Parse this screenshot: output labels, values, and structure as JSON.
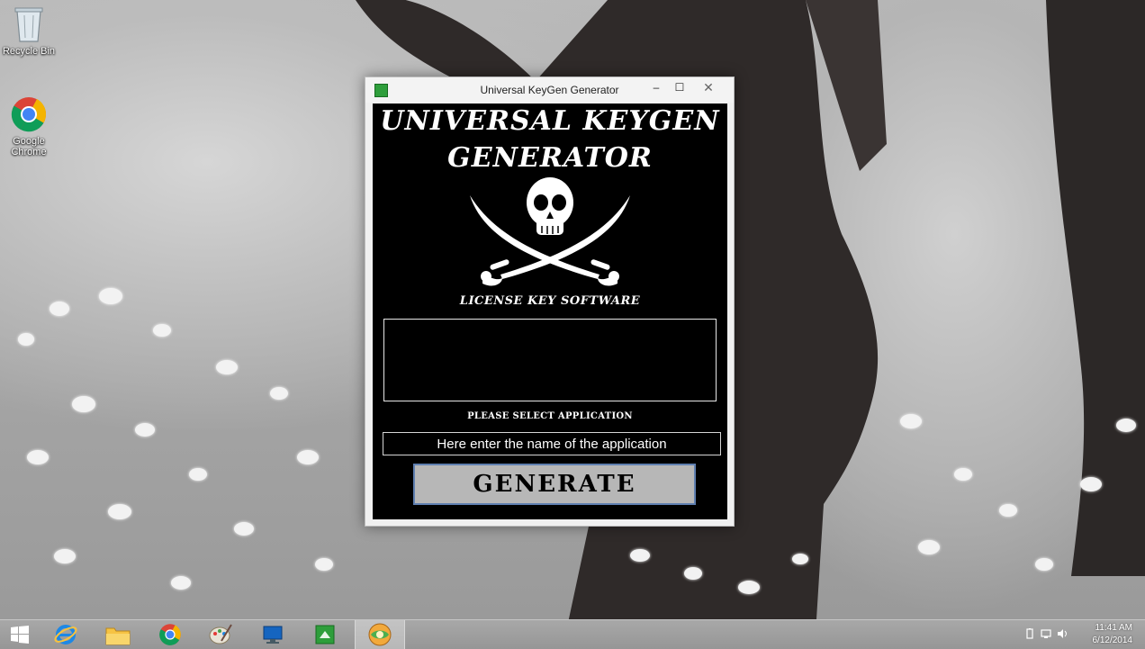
{
  "desktop": {
    "icons": [
      {
        "label": "Recycle Bin",
        "icon": "recycle-bin-icon"
      },
      {
        "label": "Google Chrome",
        "icon": "chrome-icon"
      }
    ]
  },
  "window": {
    "title": "Universal KeyGen Generator",
    "minimize_glyph": "–",
    "maximize_glyph": "☐",
    "close_glyph": "✕",
    "heading_line1": "UNIVERSAL KEYGEN",
    "heading_line2": "GENERATOR",
    "subtitle": "LICENSE KEY SOFTWARE",
    "output_value": "",
    "select_label": "PLEASE SELECT APPLICATION",
    "app_input_value": "Here enter the name of the application",
    "generate_label": "GENERATE"
  },
  "taskbar": {
    "items": [
      "start-icon",
      "internet-explorer-icon",
      "file-explorer-icon",
      "chrome-icon",
      "paint-icon",
      "remote-desktop-icon",
      "keygen-app-icon",
      "browser-app-icon"
    ],
    "active_item": "browser-app-icon"
  },
  "tray": {
    "time": "11:41 AM",
    "date": "6/12/2014"
  },
  "colors": {
    "window_client": "#000000",
    "button_face": "#b7b7b7",
    "button_border": "#5f7fb0",
    "taskbar": "#9e9e9e"
  }
}
